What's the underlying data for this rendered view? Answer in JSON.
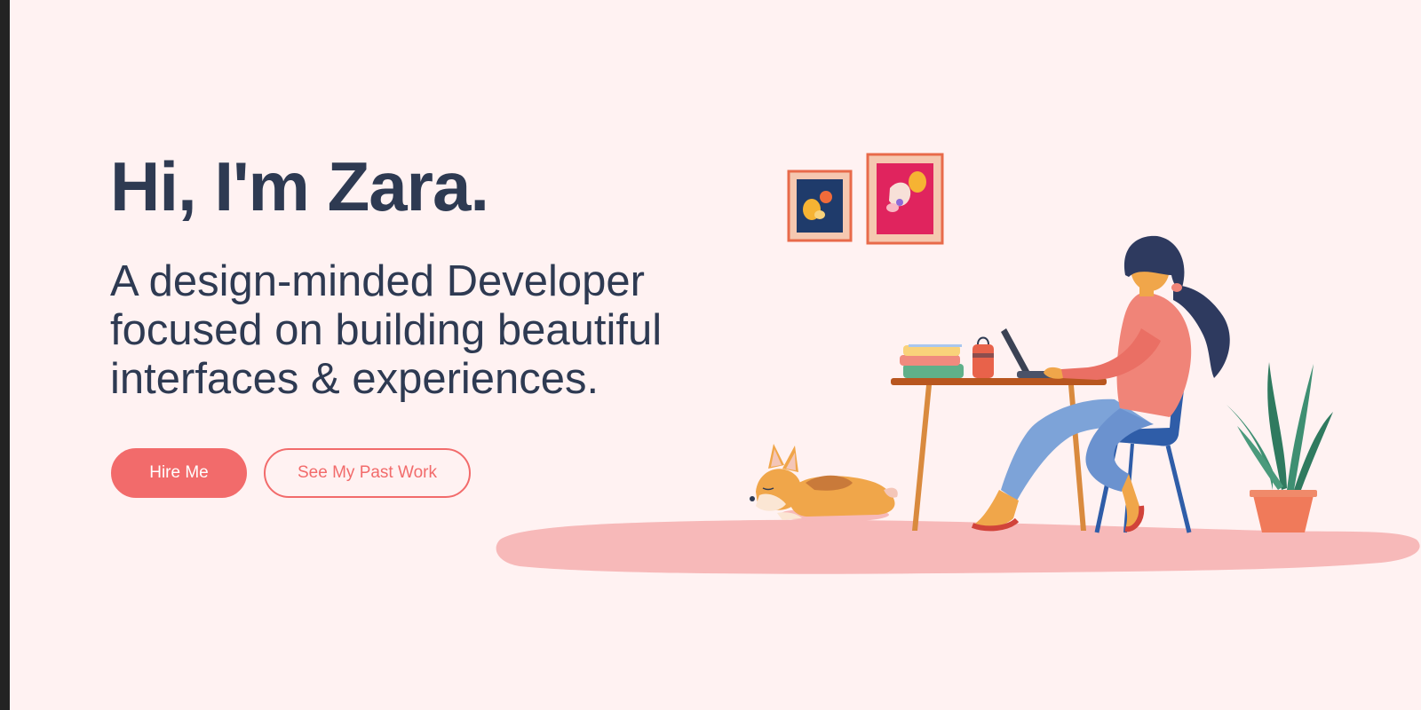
{
  "hero": {
    "title": "Hi, I'm Zara.",
    "subtitle": "A design-minded Developer focused on building beautiful interfaces & experiences."
  },
  "actions": {
    "primary_label": "Hire Me",
    "secondary_label": "See My Past Work"
  },
  "colors": {
    "page_background": "#fff2f2",
    "heading_text": "#2e3a52",
    "accent": "#f26b6b",
    "floor_rug": "#f7b9b9"
  },
  "illustration": {
    "icons": [
      "framed-art-small-icon",
      "framed-art-large-icon",
      "books-icon",
      "mug-icon",
      "laptop-icon",
      "desk-icon",
      "chair-icon",
      "woman-developer-icon",
      "dog-icon",
      "potted-plant-icon",
      "rug-icon"
    ]
  }
}
